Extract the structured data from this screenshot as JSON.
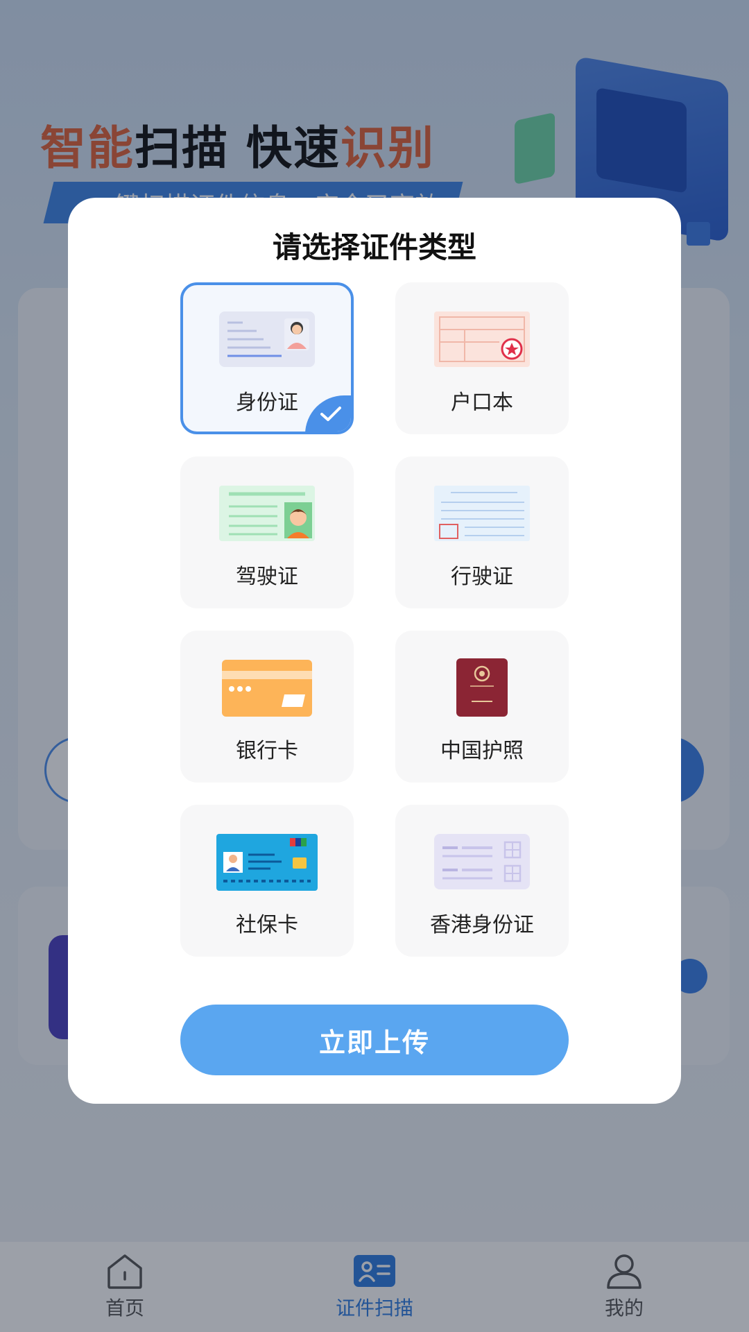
{
  "hero": {
    "title_part1": "智能",
    "title_part2": "扫描 快速",
    "title_part3": "识别",
    "subtitle": "一键扫描证件信息，安全又高效"
  },
  "modal": {
    "title": "请选择证件类型",
    "options": [
      {
        "label": "身份证",
        "icon": "id-card-icon",
        "selected": true
      },
      {
        "label": "户口本",
        "icon": "household-register-icon",
        "selected": false
      },
      {
        "label": "驾驶证",
        "icon": "driver-license-icon",
        "selected": false
      },
      {
        "label": "行驶证",
        "icon": "vehicle-license-icon",
        "selected": false
      },
      {
        "label": "银行卡",
        "icon": "bank-card-icon",
        "selected": false
      },
      {
        "label": "中国护照",
        "icon": "passport-icon",
        "selected": false
      },
      {
        "label": "社保卡",
        "icon": "social-security-card-icon",
        "selected": false
      },
      {
        "label": "香港身份证",
        "icon": "hk-id-card-icon",
        "selected": false
      }
    ],
    "upload_label": "立即上传"
  },
  "tabbar": {
    "tabs": [
      {
        "label": "首页",
        "icon": "home-icon",
        "active": false
      },
      {
        "label": "证件扫描",
        "icon": "id-scan-icon",
        "active": true
      },
      {
        "label": "我的",
        "icon": "user-icon",
        "active": false
      }
    ]
  },
  "colors": {
    "accent": "#4a90e8",
    "button": "#5aa6f0",
    "title_accent": "#e0623a"
  }
}
